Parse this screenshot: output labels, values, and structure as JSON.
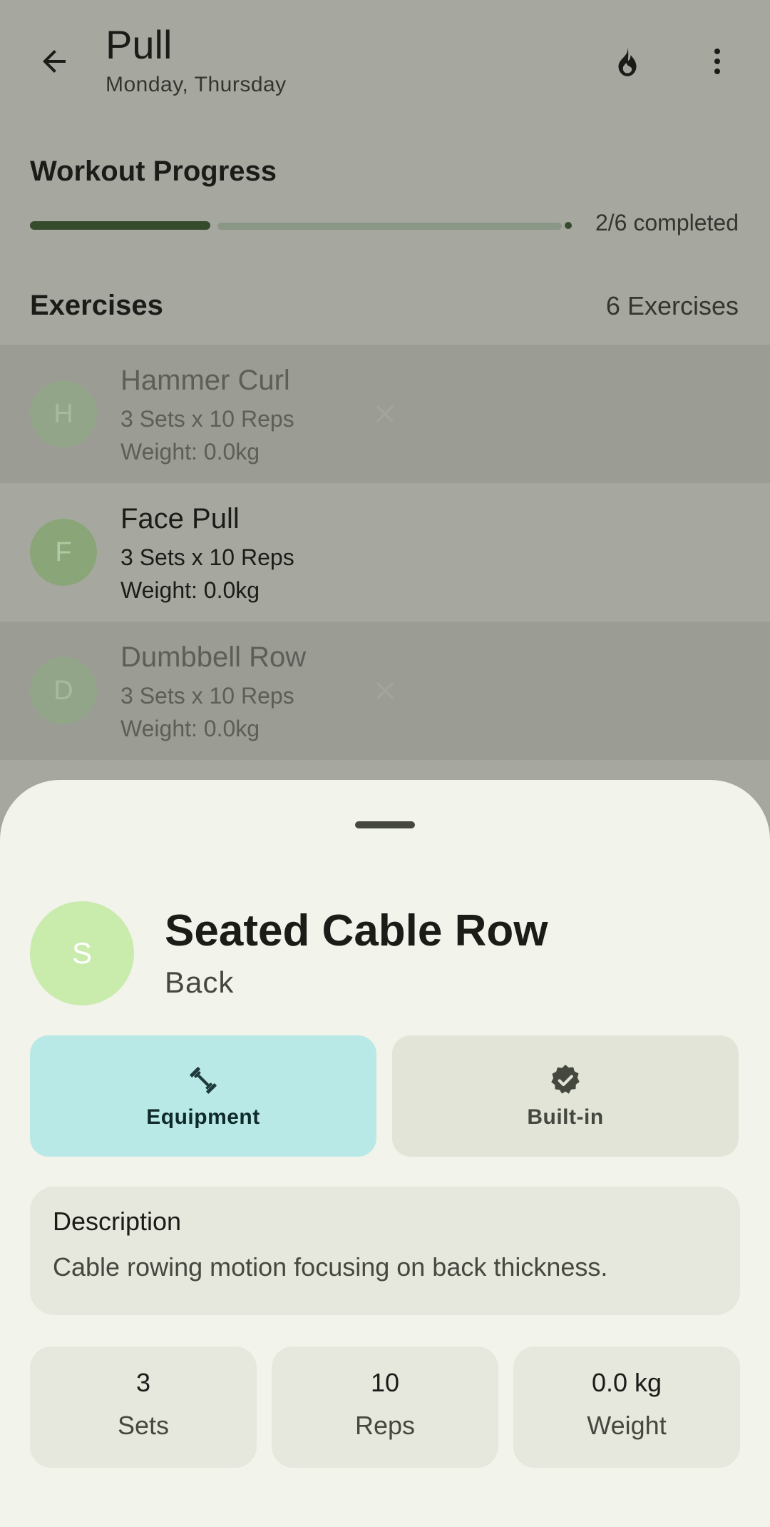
{
  "header": {
    "title": "Pull",
    "subtitle": "Monday, Thursday",
    "back_icon": "arrow-back-icon",
    "streak_icon": "fire-icon",
    "menu_icon": "more-vert-icon"
  },
  "progress": {
    "heading": "Workout Progress",
    "completed": 2,
    "total": 6,
    "fraction": 0.3333,
    "label": "2/6 completed"
  },
  "exercises": {
    "heading": "Exercises",
    "count_label": "6 Exercises",
    "items": [
      {
        "initial": "H",
        "name": "Hammer Curl",
        "sets_reps": "3 Sets x 10 Reps",
        "weight": "Weight: 0.0kg",
        "completed": true
      },
      {
        "initial": "F",
        "name": "Face Pull",
        "sets_reps": "3 Sets x 10 Reps",
        "weight": "Weight: 0.0kg",
        "completed": false
      },
      {
        "initial": "D",
        "name": "Dumbbell Row",
        "sets_reps": "3 Sets x 10 Reps",
        "weight": "Weight: 0.0kg",
        "completed": true
      }
    ]
  },
  "sheet": {
    "initial": "S",
    "title": "Seated Cable Row",
    "category": "Back",
    "chips": [
      {
        "icon": "dumbbell-icon",
        "label": "Equipment"
      },
      {
        "icon": "verified-icon",
        "label": "Built-in"
      }
    ],
    "description": {
      "title": "Description",
      "text": "Cable rowing motion focusing on back thickness."
    },
    "stats": [
      {
        "value": "3",
        "label": "Sets"
      },
      {
        "value": "10",
        "label": "Reps"
      },
      {
        "value": "0.0 kg",
        "label": "Weight"
      }
    ]
  },
  "colors": {
    "scrim_background": "#a6a8a0",
    "progress_fill": "#364b2b",
    "sheet_background": "#f2f3ea",
    "equipment_chip": "#b9e9e6",
    "builtin_chip": "#e1e4d7",
    "avatar_large": "#c9ebac"
  }
}
